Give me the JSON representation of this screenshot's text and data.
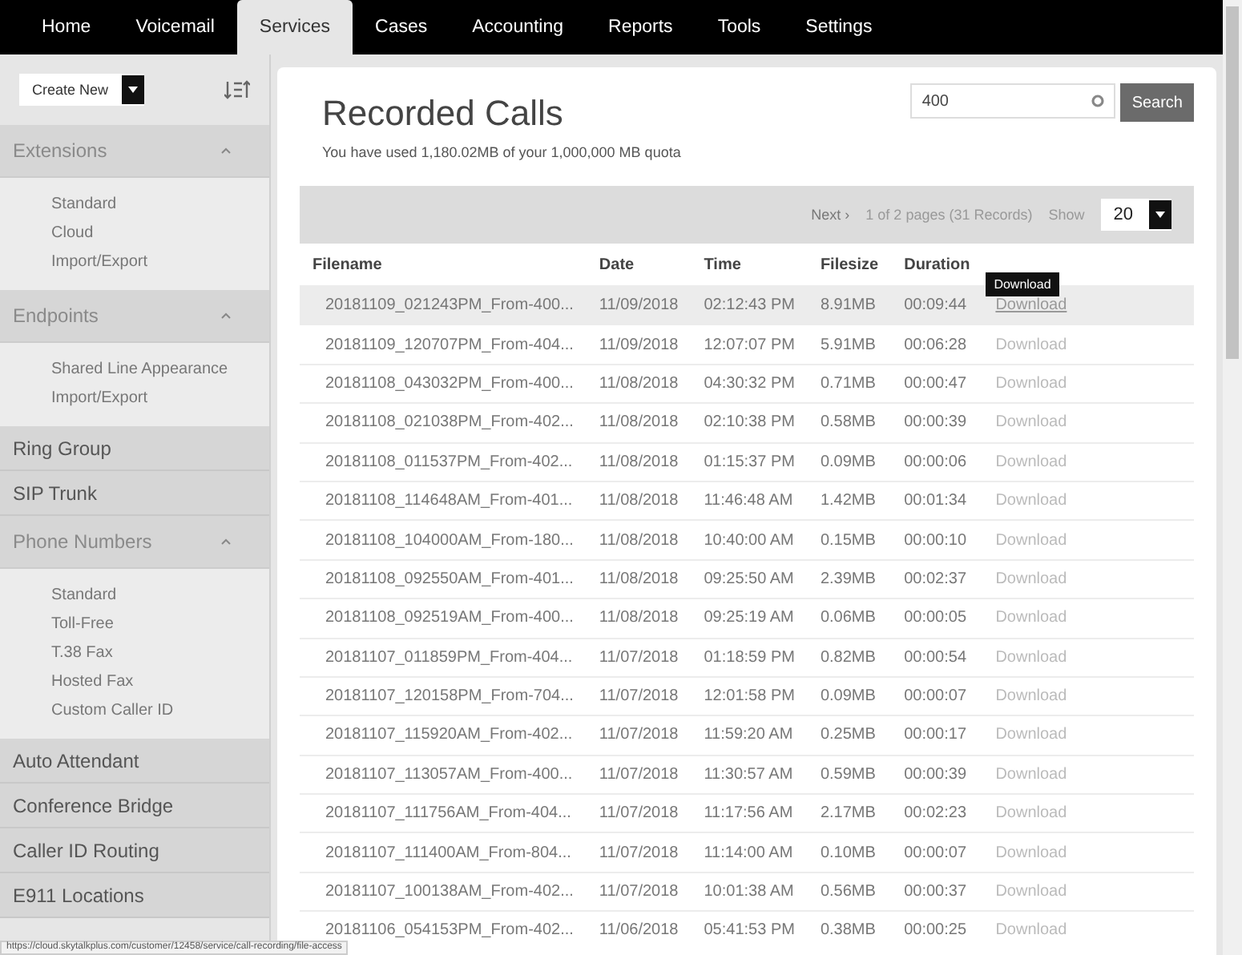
{
  "nav": [
    {
      "label": "Home",
      "selected": false
    },
    {
      "label": "Voicemail",
      "selected": false
    },
    {
      "label": "Services",
      "selected": true
    },
    {
      "label": "Cases",
      "selected": false
    },
    {
      "label": "Accounting",
      "selected": false
    },
    {
      "label": "Reports",
      "selected": false
    },
    {
      "label": "Tools",
      "selected": false
    },
    {
      "label": "Settings",
      "selected": false
    }
  ],
  "sidebar": {
    "create_button": "Create New",
    "items": [
      {
        "kind": "group",
        "label": "Extensions",
        "expanded": true,
        "children": [
          "Standard",
          "Cloud",
          "Import/Export"
        ]
      },
      {
        "kind": "group",
        "label": "Endpoints",
        "expanded": true,
        "children": [
          "Shared Line Appearance",
          "Import/Export"
        ]
      },
      {
        "kind": "item",
        "label": "Ring Group"
      },
      {
        "kind": "item",
        "label": "SIP Trunk"
      },
      {
        "kind": "group",
        "label": "Phone Numbers",
        "expanded": true,
        "children": [
          "Standard",
          "Toll-Free",
          "T.38 Fax",
          "Hosted Fax",
          "Custom Caller ID"
        ]
      },
      {
        "kind": "item",
        "label": "Auto Attendant"
      },
      {
        "kind": "item",
        "label": "Conference Bridge"
      },
      {
        "kind": "item",
        "label": "Caller ID Routing"
      },
      {
        "kind": "item",
        "label": "E911 Locations"
      }
    ]
  },
  "title": "Recorded Calls",
  "quota": "You have used 1,180.02MB of your 1,000,000 MB quota",
  "search": {
    "value": "400",
    "button": "Search"
  },
  "pager": {
    "next": "Next ›",
    "info": "1 of 2 pages (31 Records)",
    "show_label": "Show",
    "page_size": "20"
  },
  "table": {
    "columns": [
      "Filename",
      "Date",
      "Time",
      "Filesize",
      "Duration"
    ],
    "rows": [
      {
        "filename": "20181109_021243PM_From-400...",
        "date": "11/09/2018",
        "time": "02:12:43 PM",
        "size": "8.91MB",
        "duration": "00:09:44",
        "link": "Download",
        "hovered": true,
        "tooltip": "Download"
      },
      {
        "filename": "20181109_120707PM_From-404...",
        "date": "11/09/2018",
        "time": "12:07:07 PM",
        "size": "5.91MB",
        "duration": "00:06:28",
        "link": "Download",
        "hovered": false
      },
      {
        "filename": "20181108_043032PM_From-400...",
        "date": "11/08/2018",
        "time": "04:30:32 PM",
        "size": "0.71MB",
        "duration": "00:00:47",
        "link": "Download",
        "hovered": false
      },
      {
        "filename": "20181108_021038PM_From-402...",
        "date": "11/08/2018",
        "time": "02:10:38 PM",
        "size": "0.58MB",
        "duration": "00:00:39",
        "link": "Download",
        "hovered": false
      },
      {
        "filename": "20181108_011537PM_From-402...",
        "date": "11/08/2018",
        "time": "01:15:37 PM",
        "size": "0.09MB",
        "duration": "00:00:06",
        "link": "Download",
        "hovered": false
      },
      {
        "filename": "20181108_114648AM_From-401...",
        "date": "11/08/2018",
        "time": "11:46:48 AM",
        "size": "1.42MB",
        "duration": "00:01:34",
        "link": "Download",
        "hovered": false
      },
      {
        "filename": "20181108_104000AM_From-180...",
        "date": "11/08/2018",
        "time": "10:40:00 AM",
        "size": "0.15MB",
        "duration": "00:00:10",
        "link": "Download",
        "hovered": false
      },
      {
        "filename": "20181108_092550AM_From-401...",
        "date": "11/08/2018",
        "time": "09:25:50 AM",
        "size": "2.39MB",
        "duration": "00:02:37",
        "link": "Download",
        "hovered": false
      },
      {
        "filename": "20181108_092519AM_From-400...",
        "date": "11/08/2018",
        "time": "09:25:19 AM",
        "size": "0.06MB",
        "duration": "00:00:05",
        "link": "Download",
        "hovered": false
      },
      {
        "filename": "20181107_011859PM_From-404...",
        "date": "11/07/2018",
        "time": "01:18:59 PM",
        "size": "0.82MB",
        "duration": "00:00:54",
        "link": "Download",
        "hovered": false
      },
      {
        "filename": "20181107_120158PM_From-704...",
        "date": "11/07/2018",
        "time": "12:01:58 PM",
        "size": "0.09MB",
        "duration": "00:00:07",
        "link": "Download",
        "hovered": false
      },
      {
        "filename": "20181107_115920AM_From-402...",
        "date": "11/07/2018",
        "time": "11:59:20 AM",
        "size": "0.25MB",
        "duration": "00:00:17",
        "link": "Download",
        "hovered": false
      },
      {
        "filename": "20181107_113057AM_From-400...",
        "date": "11/07/2018",
        "time": "11:30:57 AM",
        "size": "0.59MB",
        "duration": "00:00:39",
        "link": "Download",
        "hovered": false
      },
      {
        "filename": "20181107_111756AM_From-404...",
        "date": "11/07/2018",
        "time": "11:17:56 AM",
        "size": "2.17MB",
        "duration": "00:02:23",
        "link": "Download",
        "hovered": false
      },
      {
        "filename": "20181107_111400AM_From-804...",
        "date": "11/07/2018",
        "time": "11:14:00 AM",
        "size": "0.10MB",
        "duration": "00:00:07",
        "link": "Download",
        "hovered": false
      },
      {
        "filename": "20181107_100138AM_From-402...",
        "date": "11/07/2018",
        "time": "10:01:38 AM",
        "size": "0.56MB",
        "duration": "00:00:37",
        "link": "Download",
        "hovered": false
      },
      {
        "filename": "20181106_054153PM_From-402...",
        "date": "11/06/2018",
        "time": "05:41:53 PM",
        "size": "0.38MB",
        "duration": "00:00:25",
        "link": "Download",
        "hovered": false
      }
    ]
  },
  "status_bar": "https://cloud.skytalkplus.com/customer/12458/service/call-recording/file-access"
}
